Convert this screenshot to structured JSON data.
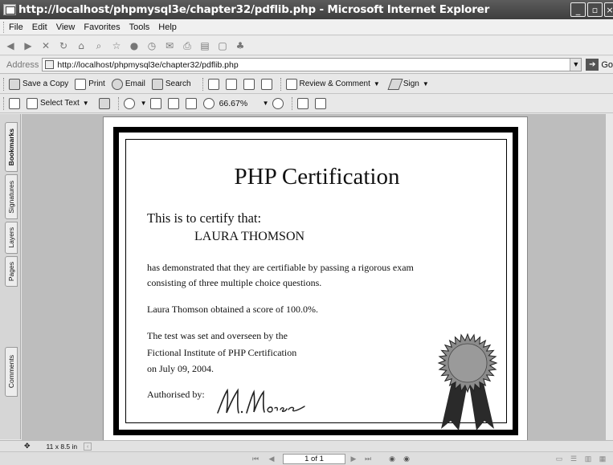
{
  "window": {
    "title": "http://localhost/phpmysql3e/chapter32/pdflib.php - Microsoft Internet Explorer"
  },
  "menu": [
    "File",
    "Edit",
    "View",
    "Favorites",
    "Tools",
    "Help"
  ],
  "address": {
    "label": "Address",
    "url": "http://localhost/phpmysql3e/chapter32/pdflib.php",
    "go_label": "Go"
  },
  "acrobat_toolbar": {
    "save_copy": "Save a Copy",
    "print": "Print",
    "email": "Email",
    "search": "Search",
    "review": "Review & Comment",
    "sign": "Sign",
    "select_text": "Select Text",
    "zoom": "66.67%"
  },
  "side_tabs": {
    "bookmarks": "Bookmarks",
    "signatures": "Signatures",
    "layers": "Layers",
    "pages": "Pages",
    "comments": "Comments"
  },
  "certificate": {
    "title": "PHP Certification",
    "intro": "This is to certify that:",
    "name": "LAURA THOMSON",
    "line1": "has demonstrated that they are certifiable by passing a rigorous exam",
    "line2": "consisting of three multiple choice questions.",
    "score": "Laura Thomson obtained a score of 100.0%.",
    "test1": "The test was set and overseen by the",
    "test2": "Fictional Institute of PHP Certification",
    "test3": "on July 09, 2004.",
    "authorised": "Authorised by:",
    "signature": "M.Morse"
  },
  "status": {
    "page_size": "11 x 8.5 in",
    "page_indicator": "1 of 1"
  },
  "colors": {
    "titlebar": "#4a4a4a",
    "seal_fill": "#8c8c8c",
    "ribbon": "#2a2a2a"
  }
}
